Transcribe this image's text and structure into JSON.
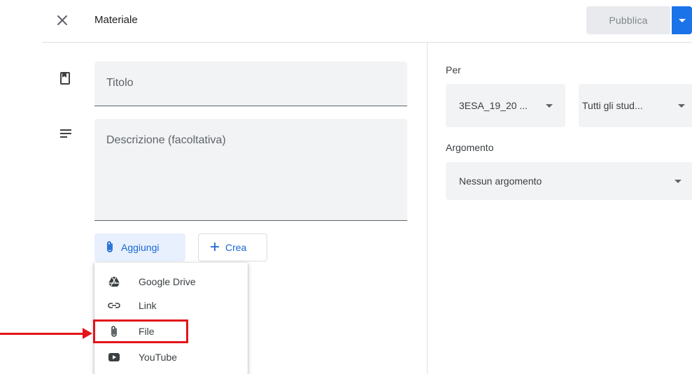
{
  "header": {
    "title": "Materiale",
    "publish_label": "Pubblica"
  },
  "form": {
    "title_placeholder": "Titolo",
    "description_placeholder": "Descrizione (facoltativa)",
    "add_label": "Aggiungi",
    "create_label": "Crea"
  },
  "add_menu": {
    "items": [
      {
        "label": "Google Drive",
        "icon": "google-drive-icon"
      },
      {
        "label": "Link",
        "icon": "link-icon"
      },
      {
        "label": "File",
        "icon": "paperclip-icon"
      },
      {
        "label": "YouTube",
        "icon": "youtube-icon"
      }
    ]
  },
  "sidebar": {
    "for_label": "Per",
    "class_value": "3ESA_19_20 ...",
    "students_value": "Tutti gli stud...",
    "topic_label": "Argomento",
    "topic_value": "Nessun argomento"
  },
  "colors": {
    "accent": "#1a73e8",
    "annotation": "#e3141b"
  }
}
